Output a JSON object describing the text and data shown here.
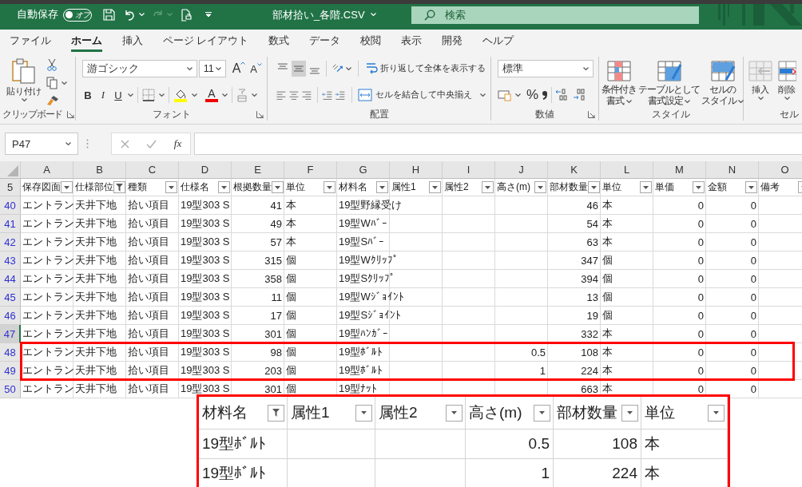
{
  "title_bar": {
    "autosave_label": "自動保存",
    "autosave": {
      "label": "オフ",
      "on": false
    },
    "title": "部材拾い_各階.CSV",
    "search": {
      "placeholder": "検索"
    }
  },
  "tabs": [
    {
      "label": "ファイル",
      "selected": false
    },
    {
      "label": "ホーム",
      "selected": true
    },
    {
      "label": "挿入",
      "selected": false
    },
    {
      "label": "ページ レイアウト",
      "selected": false
    },
    {
      "label": "数式",
      "selected": false
    },
    {
      "label": "データ",
      "selected": false
    },
    {
      "label": "校閲",
      "selected": false
    },
    {
      "label": "表示",
      "selected": false
    },
    {
      "label": "開発",
      "selected": false
    },
    {
      "label": "ヘルプ",
      "selected": false
    }
  ],
  "ribbon": {
    "clipboard": {
      "paste": "貼り付け",
      "label": "クリップボード"
    },
    "font": {
      "font_name": "游ゴシック",
      "font_size": "11",
      "grow": "A",
      "shrink": "A",
      "bold": "B",
      "italic": "I",
      "underline": "U",
      "font_color": "A",
      "label": "フォント"
    },
    "alignment": {
      "vertical_align_buttons": [
        {
          "kind": "top",
          "selected": false
        },
        {
          "kind": "middle",
          "selected": true
        },
        {
          "kind": "bottom",
          "selected": false
        }
      ],
      "wrap": "折り返して全体を表示する",
      "merge": "セルを結合して中央揃え",
      "label": "配置"
    },
    "number": {
      "format": "標準",
      "percent": "%",
      "label": "数値"
    },
    "styles": {
      "buttons": [
        {
          "kind": "conditional",
          "lines": [
            "条件付き",
            "書式"
          ]
        },
        {
          "kind": "table",
          "lines": [
            "テーブルとして",
            "書式設定"
          ]
        },
        {
          "kind": "cell",
          "lines": [
            "セルの",
            "スタイル"
          ]
        }
      ],
      "label": "スタイル"
    },
    "cells": {
      "insert": "挿入",
      "delete": "削除",
      "label": "セル"
    }
  },
  "formula_bar": {
    "name_box": "P47",
    "function_label": "fx"
  },
  "sheet": {
    "header_row": "5",
    "columns": [
      {
        "letter": "A",
        "header": "保存図面",
        "kind": "text",
        "filtered": false
      },
      {
        "letter": "B",
        "header": "仕様部位",
        "kind": "text",
        "filtered": true
      },
      {
        "letter": "C",
        "header": "種類",
        "kind": "text",
        "filtered": false
      },
      {
        "letter": "D",
        "header": "仕様名",
        "kind": "text",
        "filtered": false
      },
      {
        "letter": "E",
        "header": "根拠数量",
        "kind": "number",
        "filtered": false
      },
      {
        "letter": "F",
        "header": "単位",
        "kind": "text",
        "filtered": false
      },
      {
        "letter": "G",
        "header": "材料名",
        "kind": "text",
        "filtered": false
      },
      {
        "letter": "H",
        "header": "属性1",
        "kind": "text",
        "filtered": false
      },
      {
        "letter": "I",
        "header": "属性2",
        "kind": "text",
        "filtered": false
      },
      {
        "letter": "J",
        "header": "高さ(m)",
        "kind": "number",
        "filtered": false
      },
      {
        "letter": "K",
        "header": "部材数量",
        "kind": "number",
        "filtered": false
      },
      {
        "letter": "L",
        "header": "単位",
        "kind": "text",
        "filtered": false
      },
      {
        "letter": "M",
        "header": "単価",
        "kind": "number",
        "filtered": false
      },
      {
        "letter": "N",
        "header": "金額",
        "kind": "number",
        "filtered": false
      },
      {
        "letter": "O",
        "header": "備考",
        "kind": "text",
        "filtered": false
      }
    ],
    "rows": [
      {
        "number": "40",
        "active": false,
        "highlighted": false,
        "cells": [
          "エントラン",
          "天井下地",
          "拾い項目",
          "19型303 S",
          "41",
          "本",
          "19型野縁受け",
          null,
          null,
          null,
          "46",
          "本",
          "0",
          "0",
          null
        ]
      },
      {
        "number": "41",
        "active": false,
        "highlighted": false,
        "cells": [
          "エントラン",
          "天井下地",
          "拾い項目",
          "19型303 S",
          "49",
          "本",
          "19型Wﾊﾞｰ",
          null,
          null,
          null,
          "54",
          "本",
          "0",
          "0",
          null
        ]
      },
      {
        "number": "42",
        "active": false,
        "highlighted": false,
        "cells": [
          "エントラン",
          "天井下地",
          "拾い項目",
          "19型303 S",
          "57",
          "本",
          "19型Sﾊﾞｰ",
          null,
          null,
          null,
          "63",
          "本",
          "0",
          "0",
          null
        ]
      },
      {
        "number": "43",
        "active": false,
        "highlighted": false,
        "cells": [
          "エントラン",
          "天井下地",
          "拾い項目",
          "19型303 S",
          "315",
          "個",
          "19型Wｸﾘｯﾌﾟ",
          null,
          null,
          null,
          "347",
          "個",
          "0",
          "0",
          null
        ]
      },
      {
        "number": "44",
        "active": false,
        "highlighted": false,
        "cells": [
          "エントラン",
          "天井下地",
          "拾い項目",
          "19型303 S",
          "358",
          "個",
          "19型Sｸﾘｯﾌﾟ",
          null,
          null,
          null,
          "394",
          "個",
          "0",
          "0",
          null
        ]
      },
      {
        "number": "45",
        "active": false,
        "highlighted": false,
        "cells": [
          "エントラン",
          "天井下地",
          "拾い項目",
          "19型303 S",
          "11",
          "個",
          "19型Wｼﾞｮｲﾝﾄ",
          null,
          null,
          null,
          "13",
          "個",
          "0",
          "0",
          null
        ]
      },
      {
        "number": "46",
        "active": false,
        "highlighted": false,
        "cells": [
          "エントラン",
          "天井下地",
          "拾い項目",
          "19型303 S",
          "17",
          "個",
          "19型Sｼﾞｮｲﾝﾄ",
          null,
          null,
          null,
          "19",
          "個",
          "0",
          "0",
          null
        ]
      },
      {
        "number": "47",
        "active": true,
        "highlighted": false,
        "cells": [
          "エントラン",
          "天井下地",
          "拾い項目",
          "19型303 S",
          "301",
          "個",
          "19型ﾊﾝｶﾞｰ",
          null,
          null,
          null,
          "332",
          "本",
          "0",
          "0",
          null
        ]
      },
      {
        "number": "48",
        "active": false,
        "highlighted": true,
        "cells": [
          "エントラン",
          "天井下地",
          "拾い項目",
          "19型303 S",
          "98",
          "個",
          "19型ﾎﾞﾙﾄ",
          null,
          null,
          "0.5",
          "108",
          "本",
          "0",
          "0",
          null
        ]
      },
      {
        "number": "49",
        "active": false,
        "highlighted": true,
        "cells": [
          "エントラン",
          "天井下地",
          "拾い項目",
          "19型303 S",
          "203",
          "個",
          "19型ﾎﾞﾙﾄ",
          null,
          null,
          "1",
          "224",
          "本",
          "0",
          "0",
          null
        ]
      },
      {
        "number": "50",
        "active": false,
        "highlighted": false,
        "cells": [
          "エントラン",
          "天井下地",
          "拾い項目",
          "19型303 S",
          "301",
          "個",
          "19型ﾅｯﾄ",
          null,
          null,
          null,
          "663",
          "本",
          "0",
          "0",
          null
        ]
      }
    ]
  },
  "inset": {
    "columns": [
      {
        "header": "材料名",
        "kind": "text",
        "filtered": true
      },
      {
        "header": "属性1",
        "kind": "text",
        "filtered": false
      },
      {
        "header": "属性2",
        "kind": "text",
        "filtered": false
      },
      {
        "header": "高さ(m)",
        "kind": "number",
        "filtered": false
      },
      {
        "header": "部材数量",
        "kind": "number",
        "filtered": false
      },
      {
        "header": "単位",
        "kind": "text",
        "filtered": false
      }
    ],
    "rows": [
      [
        "19型ﾎﾞﾙﾄ",
        null,
        null,
        "0.5",
        "108",
        "本"
      ],
      [
        "19型ﾎﾞﾙﾄ",
        null,
        null,
        "1",
        "224",
        "本"
      ]
    ]
  }
}
